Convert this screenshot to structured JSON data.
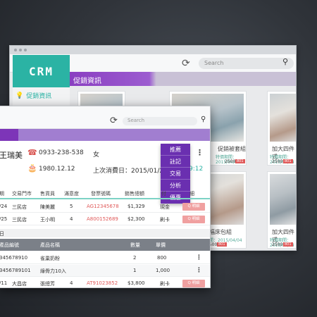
{
  "back_window": {
    "logo": "CRM",
    "search_placeholder": "Search",
    "sidebar_item": "促銷資訊",
    "banner": "促銷資訊",
    "products": [
      {
        "title": "",
        "date": "",
        "price": "",
        "badge": ""
      },
      {
        "title": "促銷被套組",
        "date": "特價期間：2015/04/04",
        "price": "2500",
        "badge": "801"
      },
      {
        "title": "加大四件式",
        "date": "特價期間：2015/04/04",
        "price": "2500",
        "badge": "801"
      },
      {
        "title": "",
        "date": "",
        "price": "",
        "badge": ""
      },
      {
        "title": "一幸福床包組",
        "date": "特價期間：2015/04/04",
        "price": "2500",
        "badge": "801"
      },
      {
        "title": "加大四件式",
        "date": "特價期間：2015/04/04",
        "price": "2500",
        "badge": "801"
      }
    ]
  },
  "front_window": {
    "search_placeholder": "Search",
    "customer": {
      "name": "王瑞美",
      "phone": "0933-238-538",
      "gender": "女",
      "birthday": "1980.12.12",
      "last_purchase": "上次消費日：2015/01/23",
      "last_time_tail": "9:12"
    },
    "action_menu": [
      "推薦",
      "註記",
      "交易",
      "分析",
      "優惠"
    ],
    "table": {
      "headers": [
        "期",
        "交易門市",
        "售貨員",
        "滿意度",
        "發票號碼",
        "銷售總額",
        "付",
        "細"
      ],
      "rows": [
        {
          "date": "/24",
          "store": "三民店",
          "clerk": "陳美麗",
          "score": "5",
          "invoice": "AG12345678",
          "total": "$1,329",
          "pay": "現金",
          "btn": "Q 明細"
        },
        {
          "date": "/25",
          "store": "三民店",
          "clerk": "王小明",
          "score": "4",
          "invoice": "A800152689",
          "total": "$2,300",
          "pay": "刷卡",
          "btn": "Q 明細"
        }
      ]
    },
    "sub_label": "日",
    "sub_table": {
      "headers": [
        "產品編號",
        "產品名稱",
        "數量",
        "單價"
      ],
      "rows": [
        {
          "code": "345678910",
          "name": "雀巢奶粉",
          "qty": "2",
          "price": "800"
        },
        {
          "code": "3456789101",
          "name": "綠骨力10入",
          "qty": "1",
          "price": "1,000"
        }
      ]
    },
    "last_row": {
      "date": "/11",
      "store": "大昌店",
      "clerk": "張總芳",
      "score": "4",
      "invoice": "AT91023852",
      "total": "$3,800",
      "pay": "刷卡",
      "btn": "Q 明細"
    }
  },
  "colors": {
    "teal": "#2bb3a4",
    "purple": "#7d35b8",
    "menu_purple": "#6a2fb0",
    "red": "#e05a5a"
  }
}
